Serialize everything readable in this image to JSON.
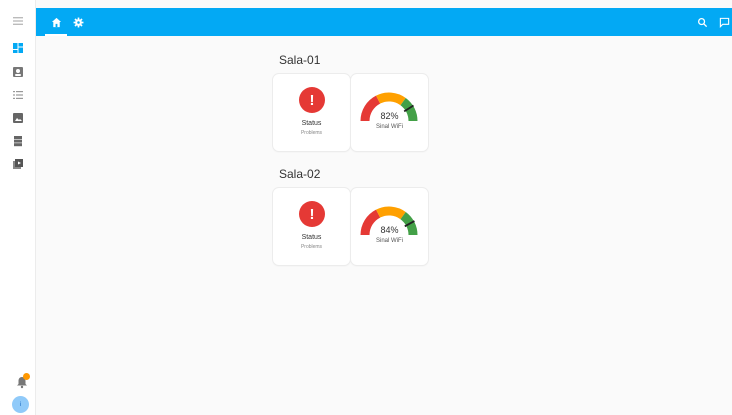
{
  "sidebar": {
    "items": [
      {
        "name": "menu-icon"
      },
      {
        "name": "dashboard-icon"
      },
      {
        "name": "person-icon"
      },
      {
        "name": "list-icon"
      },
      {
        "name": "image-icon"
      },
      {
        "name": "storage-icon"
      },
      {
        "name": "media-icon"
      }
    ],
    "notification_icon": "bell-icon",
    "avatar_initial": "i"
  },
  "topbar": {
    "color": "#03a9f4",
    "tabs": [
      {
        "name": "tab-home",
        "icon": "house-icon",
        "active": true
      },
      {
        "name": "tab-settings",
        "icon": "gear-icon",
        "active": false
      }
    ],
    "right_icons": [
      "search-icon",
      "chat-icon"
    ]
  },
  "sections": [
    {
      "title": "Sala-01",
      "status": {
        "label": "Status",
        "sub": "Problems",
        "icon_text": "!"
      },
      "gauge": {
        "value_text": "82%",
        "value": 82,
        "name": "Sinal WiFi"
      }
    },
    {
      "title": "Sala-02",
      "status": {
        "label": "Status",
        "sub": "Problems",
        "icon_text": "!"
      },
      "gauge": {
        "value_text": "84%",
        "value": 84,
        "name": "Sinal WiFi"
      }
    }
  ],
  "colors": {
    "status_error": "#e53935",
    "gauge_red": "#e53935",
    "gauge_yellow": "#ffa000",
    "gauge_green": "#43a047"
  }
}
